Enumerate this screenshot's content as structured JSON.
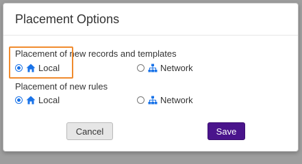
{
  "dialog": {
    "title": "Placement Options"
  },
  "sections": [
    {
      "label": "Placement of new records and templates",
      "options": [
        {
          "label": "Local",
          "icon": "home-icon",
          "selected": true
        },
        {
          "label": "Network",
          "icon": "network-icon",
          "selected": false
        }
      ]
    },
    {
      "label": "Placement of new rules",
      "options": [
        {
          "label": "Local",
          "icon": "home-icon",
          "selected": true
        },
        {
          "label": "Network",
          "icon": "network-icon",
          "selected": false
        }
      ]
    }
  ],
  "buttons": {
    "cancel_label": "Cancel",
    "save_label": "Save"
  },
  "colors": {
    "accent": "#1a73e8",
    "save_button": "#4a148c",
    "highlight": "#f08a2c"
  }
}
